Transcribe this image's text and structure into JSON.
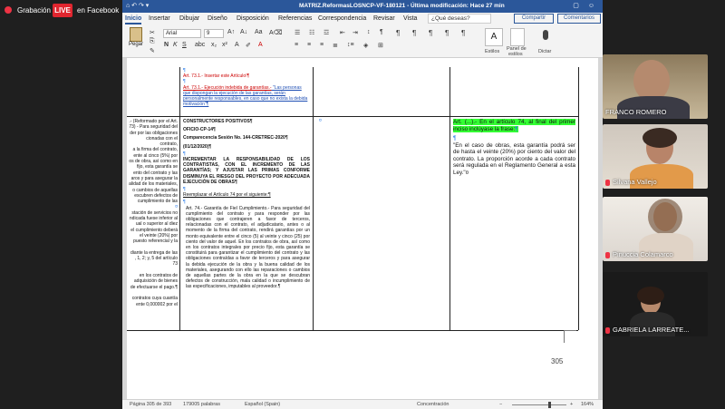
{
  "stream": {
    "recording_label": "Grabación",
    "live_badge": "LIVE",
    "destination": "en Facebook"
  },
  "word": {
    "title": "MATRIZ.ReformasLOSNCP-VF-180121 - Última modificación: Hace 27 min",
    "tabs": [
      "Inicio",
      "Insertar",
      "Dibujar",
      "Diseño",
      "Disposición",
      "Referencias",
      "Correspondencia",
      "Revisar",
      "Vista"
    ],
    "search_placeholder": "¿Qué deseas?",
    "share_label": "Compartir",
    "comments_label": "Comentarios",
    "paste_label": "Pegar",
    "font_family": "Arial",
    "font_size": "9",
    "ribbon_labels": {
      "styles": "Estilos",
      "panel_line1": "Panel de",
      "panel_line2": "estilos",
      "dictate": "Dictar"
    },
    "format_buttons": [
      "N",
      "K",
      "S"
    ]
  },
  "document": {
    "row1": {
      "mark1": "¶",
      "line1": "Art. 73.1.- Insertar este Artículo!¶",
      "line2": "¶",
      "line3a": "Art. 73.1.- Ejecución indebida de garantías.-",
      "line3b": " \"Las personas que dispongan la ejecución de las garantías, serán personalmente responsables, en caso que no exista la debida motivación\"¶",
      "col3_mark": "¤"
    },
    "left_fragment": [
      ".- (Reformado por el Art.",
      "73) - Para seguridad del",
      "der por las obligaciones",
      "cionadas con el contrato,",
      "a la firma del contrato,",
      "ente al cinco (5%) por",
      "os de obra, así como en",
      "fijo, esta garantía se",
      "ento del contrato y las",
      "aros y para asegurar la",
      "alidad de los materiales,",
      "o cambios de aquellas",
      "escubren defectos de",
      "cumplimiento de las",
      "¤",
      "stación de servicios no",
      "ndicada fuese inferior al",
      "ual o superior al diez",
      "el cumplimiento deberá",
      "el veinte (20%) por",
      "puesto referencial y la",
      "",
      "diante la entrega de las",
      ", 1, 2; y, 5 del artículo 73",
      "",
      "en los contratos de",
      "adquisición de bienes",
      "de efectuarse el pago.¶",
      "",
      "contratos cuya cuantía",
      "ente 0,000002 por el"
    ],
    "row2": {
      "org": "CONSTRUCTORES POSITIVOS¶",
      "office": "OFICIO-CP-14¶",
      "session": "Comparecencia Sesión No. 144-CRETREC-2020¶",
      "date": "(01/12/2020)¶",
      "blank1": "¶",
      "heading": "INCREMENTAR LA RESPONSABILIDAD DE LOS CONTRATISTAS, CON EL INCREMENTO DE LAS GARANTÍAS; Y AJUSTAR LAS PRIMAS CONFORME DISMINUYA EL RIESGO DEL PROYECTO POR ADECUADA EJECUCIÓN DE OBRAS¶",
      "blank2": "¶",
      "replace": "Reemplazar el Artículo 74 por el siguiente:¶",
      "blank3": "¶",
      "article": "Art. 74.- Garantía de Fiel Cumplimiento.- Para seguridad del cumplimiento del contrato y para responder por las obligaciones que contrajeren a favor de terceros, relacionadas con el contrato, el adjudicatario, antes o al momento de la firma del contrato, rendirá garantías por un monto equivalente entre el cinco (5) al veinte y cinco (25) por ciento del valor de aquel. En los contratos de obra, así como en los contratos integrales por precio fijo, esta garantía se constituirá para garantizar el cumplimiento del contrato y las obligaciones contraídas a favor de terceros y para asegurar la debida ejecución de la obra y la buena calidad de los materiales, asegurando con ello las reparaciones o cambios de aquellas partes de la obra en la que se descubran defectos de construcción, mala calidad o incumplimiento de las especificaciones, imputables al proveedor.¶",
      "col3_mark": "¤",
      "proposal_highlight": "Art. (...).- En el artículo 74, al final del primer inciso inclúyase la frase:",
      "proposal_mark": "¶",
      "blank4": "¶",
      "quote": "\"En el caso de obras, esta garantía podrá ser de hasta el veinte (20%) por ciento del valor del contrato. La proporción acorde a cada contrato será regulada en el Reglamento General a esta Ley.\"¤"
    },
    "page_number": "305"
  },
  "statusbar": {
    "page": "Página 305 de 393",
    "words": "179005 palabras",
    "language": "Español (Spain)",
    "focus": "Concentración",
    "zoom": "164%",
    "zoom_fraction": 0.67
  },
  "participants": [
    {
      "name": "FRANCO ROMERO",
      "muted": false
    },
    {
      "name": "Silvana Vallejo",
      "muted": true
    },
    {
      "name": "Pinuccia Colamarco",
      "muted": true
    },
    {
      "name": "GABRIELA LARREATE...",
      "muted": true
    }
  ],
  "colors": {
    "word_blue": "#2b579a",
    "live_red": "#e0262f",
    "highlight_green": "#33ff33",
    "tracked_red": "#c00000",
    "tracked_blue": "#1f4fb4"
  }
}
